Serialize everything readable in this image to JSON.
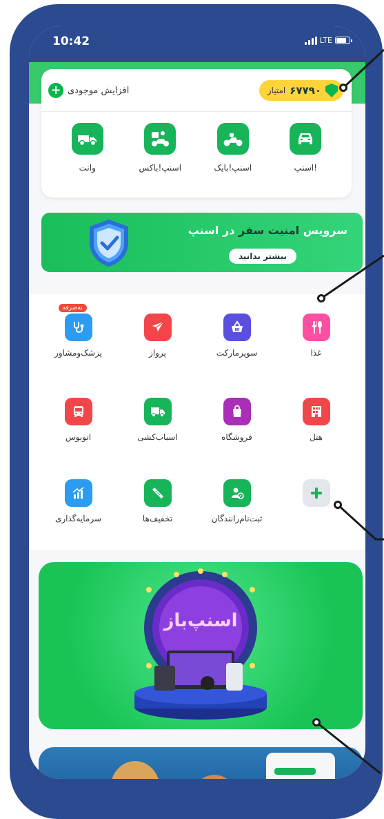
{
  "status": {
    "time": "10:42",
    "network": "LTE"
  },
  "wallet": {
    "add_balance_label": "افزایش موجودی",
    "points_value": "۶۷۷۹۰",
    "points_label": "امتیاز"
  },
  "services": [
    {
      "label": "اسنپ!",
      "icon": "car-icon"
    },
    {
      "label": "اسنپ‌!بایک",
      "icon": "motorbike-icon"
    },
    {
      "label": "اسنپ‌!باکس",
      "icon": "delivery-courier-icon"
    },
    {
      "label": "وانت",
      "icon": "pickup-truck-icon"
    }
  ],
  "safety_banner": {
    "title_prefix": "سرویس",
    "title_highlight": "امنیت سفر",
    "title_suffix": "در اسنپ",
    "button_label": "بیشتر بدانید"
  },
  "grid": {
    "row1": [
      {
        "label": "غذا",
        "color": "#ff4fa3",
        "icon": "fork-spoon-icon"
      },
      {
        "label": "سوپرمارکت",
        "color": "#5b4fe0",
        "icon": "basket-icon"
      },
      {
        "label": "پرواز",
        "color": "#f2464a",
        "icon": "airplane-icon"
      },
      {
        "label": "پزشک‌ومشاور",
        "color": "#2b9cf2",
        "icon": "stethoscope-icon",
        "tag": "به‌صرفه"
      }
    ],
    "row2": [
      {
        "label": "هتل",
        "color": "#f2464a",
        "icon": "building-icon"
      },
      {
        "label": "فروشگاه",
        "color": "#a82fb6",
        "icon": "shopping-bag-icon"
      },
      {
        "label": "اسباب‌کشی",
        "color": "#17b45a",
        "icon": "moving-truck-icon"
      },
      {
        "label": "اتوبوس",
        "color": "#f2464a",
        "icon": "bus-icon"
      }
    ],
    "row3": [
      {
        "label": "",
        "color": "#e3e6ea",
        "icon": "plus-icon"
      },
      {
        "label": "ثبت‌نام‌رانندگان",
        "color": "#17b45a",
        "icon": "driver-icon"
      },
      {
        "label": "تخفیف‌ها",
        "color": "#17b45a",
        "icon": "ticket-icon"
      },
      {
        "label": "سرمایه‌گذاری",
        "color": "#2b9cf2",
        "icon": "growth-chart-icon"
      }
    ]
  },
  "promo_banner": {
    "title": "اسنپ‌باز"
  }
}
